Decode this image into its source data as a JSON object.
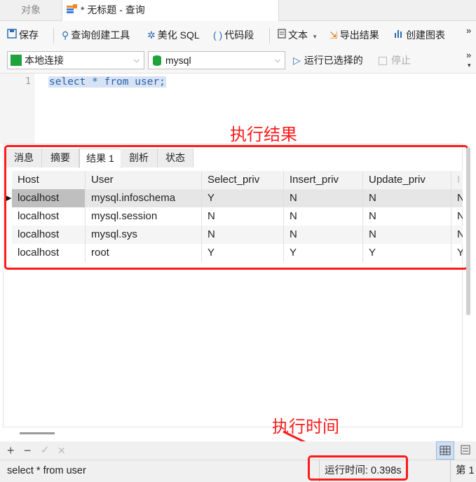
{
  "tabs": {
    "objects": "对象",
    "query": "* 无标题 - 查询"
  },
  "toolbar": {
    "save": "保存",
    "query_builder": "查询创建工具",
    "beautify": "美化 SQL",
    "snippet": "代码段",
    "text": "文本",
    "export": "导出结果",
    "chart": "创建图表",
    "overflow": "»"
  },
  "connection": {
    "connection_name": "本地连接",
    "database": "mysql",
    "run_selected": "运行已选择的",
    "stop": "停止",
    "overflow": "»"
  },
  "editor": {
    "line_number": "1",
    "code": "select * from user;"
  },
  "annotations": {
    "result_label": "执行结果",
    "time_label": "执行时间"
  },
  "result_tabs": [
    "消息",
    "摘要",
    "结果 1",
    "剖析",
    "状态"
  ],
  "result_table": {
    "columns": [
      "Host",
      "User",
      "Select_priv",
      "Insert_priv",
      "Update_priv",
      "I"
    ],
    "rows": [
      [
        "localhost",
        "mysql.infoschema",
        "Y",
        "N",
        "N",
        "N"
      ],
      [
        "localhost",
        "mysql.session",
        "N",
        "N",
        "N",
        "N"
      ],
      [
        "localhost",
        "mysql.sys",
        "N",
        "N",
        "N",
        "N"
      ],
      [
        "localhost",
        "root",
        "Y",
        "Y",
        "Y",
        "Y"
      ]
    ]
  },
  "bottom_toolbar": {
    "add": "+",
    "remove": "−",
    "apply": "✓",
    "discard": "✕"
  },
  "status": {
    "sql": "select * from user",
    "run_time": "运行时间: 0.398s",
    "page": "第 1"
  },
  "colors": {
    "annotation_red": "#ff1a1a",
    "selection_blue": "#d5e3f5",
    "keyword_blue": "#3161a8"
  }
}
